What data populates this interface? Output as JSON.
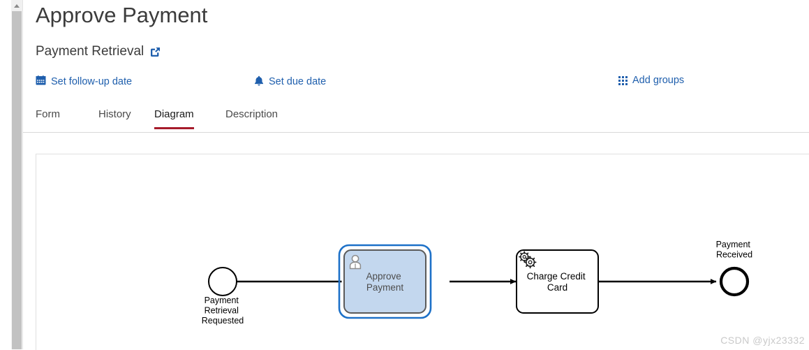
{
  "window": {
    "scrollbar": {
      "name": "vertical-scrollbar",
      "arrow": "scroll-up-arrow"
    }
  },
  "header": {
    "title": "Approve Payment",
    "subtitle": "Payment Retrieval",
    "subtitle_link_icon": "external-link-icon"
  },
  "actions": [
    {
      "id": "set-follow-up-date",
      "label": "Set follow-up date",
      "icon": "calendar-icon",
      "color": "#1f5fad"
    },
    {
      "id": "set-due-date",
      "label": "Set due date",
      "icon": "bell-icon",
      "color": "#1f5fad"
    },
    {
      "id": "add-groups",
      "label": "Add groups",
      "icon": "grid-icon",
      "color": "#1f5fad"
    }
  ],
  "tabs": [
    {
      "id": "form",
      "label": "Form",
      "active": false
    },
    {
      "id": "history",
      "label": "History",
      "active": false
    },
    {
      "id": "diagram",
      "label": "Diagram",
      "active": true
    },
    {
      "id": "description",
      "label": "Description",
      "active": false
    }
  ],
  "tab_active_underline_color": "#a61b2b",
  "diagram": {
    "type": "bpmn-process",
    "selected_element": "Approve Payment",
    "elements": [
      {
        "id": "start-event",
        "type": "start-event",
        "label": "Payment Retrieval Requested",
        "label_position": "below"
      },
      {
        "id": "approve-payment-task",
        "type": "user-task",
        "label": "Approve Payment",
        "icon": "user-icon",
        "selected": true,
        "fill": "#c3d7ee",
        "selection_color": "#1d71c8"
      },
      {
        "id": "charge-credit-card-task",
        "type": "service-task",
        "label": "Charge Credit Card",
        "icon": "gear-icon",
        "selected": false,
        "fill": "#ffffff"
      },
      {
        "id": "end-event",
        "type": "end-event",
        "label": "Payment Received",
        "label_position": "above"
      }
    ],
    "flows": [
      {
        "from": "start-event",
        "to": "approve-payment-task"
      },
      {
        "from": "approve-payment-task",
        "to": "charge-credit-card-task"
      },
      {
        "from": "charge-credit-card-task",
        "to": "end-event"
      }
    ]
  },
  "watermark": {
    "text": "CSDN @yjx23332"
  }
}
